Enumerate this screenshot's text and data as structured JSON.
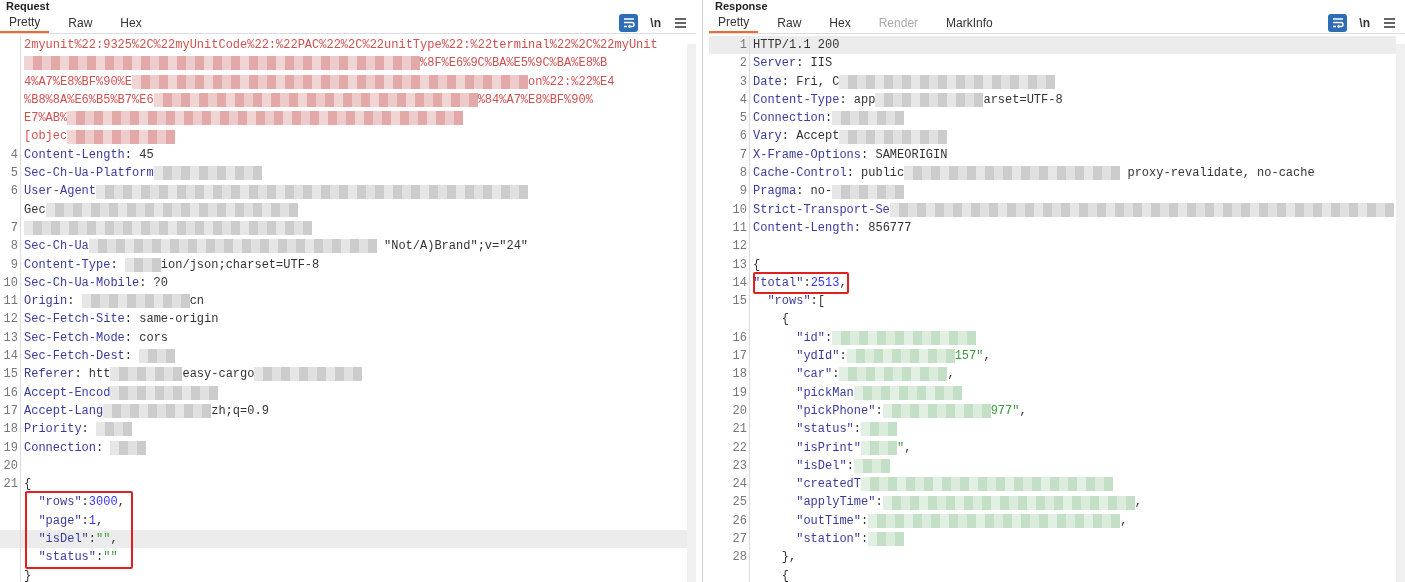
{
  "panels": [
    {
      "title": "Request",
      "tabs": [
        {
          "label": "Pretty",
          "selected": true,
          "disabled": false
        },
        {
          "label": "Raw",
          "selected": false,
          "disabled": false
        },
        {
          "label": "Hex",
          "selected": false,
          "disabled": false
        }
      ],
      "wrap_on": true,
      "newline_label": "\\n",
      "rows": [
        {
          "parts": [
            {
              "kind": "error",
              "text": "2myunit%22:9325%2C%22myUnitCode%22:%22PAC%22%2C%22unitType%22:%22terminal%22%2C%22myUnit"
            }
          ]
        },
        {
          "parts": [
            {
              "kind": "redacted",
              "color": "#e3a9a9"
            },
            {
              "kind": "redacted",
              "color": "#e3a9a9"
            },
            {
              "kind": "redacted",
              "color": "#e3a9a9"
            },
            {
              "kind": "redacted",
              "color": "#e3a9a9"
            },
            {
              "kind": "redacted",
              "color": "#e3a9a9"
            },
            {
              "kind": "redacted",
              "color": "#e3a9a9"
            },
            {
              "kind": "redacted",
              "color": "#e3a9a9"
            },
            {
              "kind": "redacted",
              "color": "#e3a9a9"
            },
            {
              "kind": "redacted",
              "color": "#e3a9a9"
            },
            {
              "kind": "redacted",
              "color": "#e3a9a9"
            },
            {
              "kind": "redacted",
              "color": "#e3a9a9"
            },
            {
              "kind": "error",
              "text": "%8F%E6%9C%BA%E5%9C%BA%E8%B"
            }
          ]
        },
        {
          "parts": [
            {
              "kind": "error",
              "text": "4%A7%E8%BF%90%E"
            },
            {
              "kind": "redacted",
              "color": "#e3a9a9"
            },
            {
              "kind": "redacted",
              "color": "#e3a9a9"
            },
            {
              "kind": "redacted",
              "color": "#e3a9a9"
            },
            {
              "kind": "redacted",
              "color": "#e3a9a9"
            },
            {
              "kind": "redacted",
              "color": "#e3a9a9"
            },
            {
              "kind": "redacted",
              "color": "#e3a9a9"
            },
            {
              "kind": "redacted",
              "color": "#e3a9a9"
            },
            {
              "kind": "redacted",
              "color": "#e3a9a9"
            },
            {
              "kind": "redacted",
              "color": "#e3a9a9"
            },
            {
              "kind": "redacted",
              "color": "#e3a9a9"
            },
            {
              "kind": "redacted",
              "color": "#e3a9a9"
            },
            {
              "kind": "error",
              "text": "on%22:%22%E4"
            }
          ]
        },
        {
          "parts": [
            {
              "kind": "error",
              "text": "%B8%8A%E6%B5%B7%E6"
            },
            {
              "kind": "redacted",
              "color": "#e3a9a9"
            },
            {
              "kind": "redacted",
              "color": "#e3a9a9"
            },
            {
              "kind": "redacted",
              "color": "#e3a9a9"
            },
            {
              "kind": "redacted",
              "color": "#e3a9a9"
            },
            {
              "kind": "redacted",
              "color": "#e3a9a9"
            },
            {
              "kind": "redacted",
              "color": "#e3a9a9"
            },
            {
              "kind": "redacted",
              "color": "#e3a9a9"
            },
            {
              "kind": "redacted",
              "color": "#e3a9a9"
            },
            {
              "kind": "redacted",
              "color": "#e3a9a9"
            },
            {
              "kind": "error",
              "text": "%84%A7%E8%BF%90%"
            }
          ]
        },
        {
          "parts": [
            {
              "kind": "error",
              "text": "E7%AB%"
            },
            {
              "kind": "redacted",
              "color": "#e3a9a9"
            },
            {
              "kind": "redacted",
              "color": "#e3a9a9"
            },
            {
              "kind": "redacted",
              "color": "#e3a9a9"
            },
            {
              "kind": "redacted",
              "color": "#e3a9a9"
            },
            {
              "kind": "redacted",
              "color": "#e3a9a9"
            },
            {
              "kind": "redacted",
              "color": "#e3a9a9"
            },
            {
              "kind": "redacted",
              "color": "#e3a9a9"
            },
            {
              "kind": "redacted",
              "color": "#e3a9a9"
            },
            {
              "kind": "redacted",
              "color": "#e3a9a9"
            },
            {
              "kind": "redacted",
              "color": "#e3a9a9"
            },
            {
              "kind": "redacted",
              "color": "#e3a9a9"
            }
          ]
        },
        {
          "parts": [
            {
              "kind": "error",
              "text": "[objec"
            },
            {
              "kind": "redacted",
              "color": "#e3a9a9"
            },
            {
              "kind": "redacted",
              "color": "#e3a9a9"
            },
            {
              "kind": "redacted",
              "color": "#e3a9a9"
            }
          ]
        },
        {
          "number": "4",
          "parts": [
            {
              "kind": "key",
              "text": "Content-Length"
            },
            {
              "kind": "plain",
              "text": ": 45"
            }
          ]
        },
        {
          "number": "5",
          "parts": [
            {
              "kind": "key",
              "text": "Sec-Ch-Ua-Platform"
            },
            {
              "kind": "redacted",
              "color": "#cccccc"
            },
            {
              "kind": "redacted",
              "color": "#cccccc"
            },
            {
              "kind": "redacted",
              "color": "#cccccc"
            }
          ]
        },
        {
          "number": "6",
          "parts": [
            {
              "kind": "key",
              "text": "User-Agent"
            },
            {
              "kind": "redacted",
              "color": "#cccccc"
            },
            {
              "kind": "redacted",
              "color": "#cccccc"
            },
            {
              "kind": "redacted",
              "color": "#cccccc"
            },
            {
              "kind": "redacted",
              "color": "#cccccc"
            },
            {
              "kind": "redacted",
              "color": "#cccccc"
            },
            {
              "kind": "redacted",
              "color": "#cccccc"
            },
            {
              "kind": "redacted",
              "color": "#cccccc"
            },
            {
              "kind": "redacted",
              "color": "#cccccc"
            },
            {
              "kind": "redacted",
              "color": "#cccccc"
            },
            {
              "kind": "redacted",
              "color": "#cccccc"
            },
            {
              "kind": "redacted",
              "color": "#cccccc"
            },
            {
              "kind": "redacted",
              "color": "#cccccc"
            }
          ]
        },
        {
          "parts": [
            {
              "kind": "plain",
              "text": "Gec"
            },
            {
              "kind": "redacted",
              "color": "#cccccc"
            },
            {
              "kind": "redacted",
              "color": "#cccccc"
            },
            {
              "kind": "redacted",
              "color": "#cccccc"
            },
            {
              "kind": "redacted",
              "color": "#cccccc"
            },
            {
              "kind": "redacted",
              "color": "#cccccc"
            },
            {
              "kind": "redacted",
              "color": "#cccccc"
            },
            {
              "kind": "redacted",
              "color": "#cccccc"
            }
          ]
        },
        {
          "number": "7",
          "parts": [
            {
              "kind": "redacted",
              "color": "#cccccc"
            },
            {
              "kind": "redacted",
              "color": "#cccccc"
            },
            {
              "kind": "redacted",
              "color": "#cccccc"
            },
            {
              "kind": "redacted",
              "color": "#cccccc"
            },
            {
              "kind": "redacted",
              "color": "#cccccc"
            },
            {
              "kind": "redacted",
              "color": "#cccccc"
            },
            {
              "kind": "redacted",
              "color": "#cccccc"
            },
            {
              "kind": "redacted",
              "color": "#cccccc"
            }
          ]
        },
        {
          "number": "8",
          "parts": [
            {
              "kind": "key",
              "text": "Sec-Ch-Ua"
            },
            {
              "kind": "redacted",
              "color": "#cccccc"
            },
            {
              "kind": "redacted",
              "color": "#cccccc"
            },
            {
              "kind": "redacted",
              "color": "#cccccc"
            },
            {
              "kind": "redacted",
              "color": "#cccccc"
            },
            {
              "kind": "redacted",
              "color": "#cccccc"
            },
            {
              "kind": "redacted",
              "color": "#cccccc"
            },
            {
              "kind": "redacted",
              "color": "#cccccc"
            },
            {
              "kind": "redacted",
              "color": "#cccccc"
            },
            {
              "kind": "plain",
              "text": " \"Not/A)Brand\";v=\"24\""
            }
          ]
        },
        {
          "number": "9",
          "parts": [
            {
              "kind": "key",
              "text": "Content-Type"
            },
            {
              "kind": "plain",
              "text": ": "
            },
            {
              "kind": "redacted",
              "color": "#cccccc"
            },
            {
              "kind": "plain",
              "text": "ion/json;charset=UTF-8"
            }
          ]
        },
        {
          "number": "10",
          "parts": [
            {
              "kind": "key",
              "text": "Sec-Ch-Ua-Mobile"
            },
            {
              "kind": "plain",
              "text": ": ?0"
            }
          ]
        },
        {
          "number": "11",
          "parts": [
            {
              "kind": "key",
              "text": "Origin"
            },
            {
              "kind": "plain",
              "text": ": "
            },
            {
              "kind": "redacted",
              "color": "#cccccc"
            },
            {
              "kind": "redacted",
              "color": "#cccccc"
            },
            {
              "kind": "redacted",
              "color": "#cccccc"
            },
            {
              "kind": "plain",
              "text": "cn"
            }
          ]
        },
        {
          "number": "12",
          "parts": [
            {
              "kind": "key",
              "text": "Sec-Fetch-Site"
            },
            {
              "kind": "plain",
              "text": ": same-origin"
            }
          ]
        },
        {
          "number": "13",
          "parts": [
            {
              "kind": "key",
              "text": "Sec-Fetch-Mode"
            },
            {
              "kind": "plain",
              "text": ": cors"
            }
          ]
        },
        {
          "number": "14",
          "parts": [
            {
              "kind": "key",
              "text": "Sec-Fetch-Dest"
            },
            {
              "kind": "plain",
              "text": ": "
            },
            {
              "kind": "redacted",
              "color": "#cccccc"
            }
          ]
        },
        {
          "number": "15",
          "parts": [
            {
              "kind": "key",
              "text": "Referer"
            },
            {
              "kind": "plain",
              "text": ": htt"
            },
            {
              "kind": "redacted",
              "color": "#cccccc"
            },
            {
              "kind": "redacted",
              "color": "#cccccc"
            },
            {
              "kind": "plain",
              "text": "easy-cargo"
            },
            {
              "kind": "redacted",
              "color": "#cccccc"
            },
            {
              "kind": "redacted",
              "color": "#cccccc"
            },
            {
              "kind": "redacted",
              "color": "#cccccc"
            }
          ]
        },
        {
          "number": "16",
          "parts": [
            {
              "kind": "key",
              "text": "Accept-Encod"
            },
            {
              "kind": "redacted",
              "color": "#cccccc"
            },
            {
              "kind": "redacted",
              "color": "#cccccc"
            },
            {
              "kind": "redacted",
              "color": "#cccccc"
            }
          ]
        },
        {
          "number": "17",
          "parts": [
            {
              "kind": "key",
              "text": "Accept-Lang"
            },
            {
              "kind": "redacted",
              "color": "#cccccc"
            },
            {
              "kind": "redacted",
              "color": "#cccccc"
            },
            {
              "kind": "redacted",
              "color": "#cccccc"
            },
            {
              "kind": "plain",
              "text": "zh;q=0.9"
            }
          ]
        },
        {
          "number": "18",
          "parts": [
            {
              "kind": "key",
              "text": "Priority"
            },
            {
              "kind": "plain",
              "text": ": "
            },
            {
              "kind": "redacted",
              "color": "#cccccc"
            }
          ]
        },
        {
          "number": "19",
          "parts": [
            {
              "kind": "key",
              "text": "Connection"
            },
            {
              "kind": "plain",
              "text": ": "
            },
            {
              "kind": "redacted",
              "color": "#cccccc"
            }
          ]
        },
        {
          "number": "20",
          "parts": []
        },
        {
          "number": "21",
          "parts": [
            {
              "kind": "punct",
              "text": "{"
            }
          ]
        },
        {
          "boxed": true,
          "parts": [
            {
              "kind": "key",
              "text": "  \"rows\""
            },
            {
              "kind": "punct",
              "text": ":"
            },
            {
              "kind": "number",
              "text": "3000"
            },
            {
              "kind": "punct",
              "text": ","
            }
          ]
        },
        {
          "boxed": true,
          "parts": [
            {
              "kind": "key",
              "text": "  \"page\""
            },
            {
              "kind": "punct",
              "text": ":"
            },
            {
              "kind": "number",
              "text": "1"
            },
            {
              "kind": "punct",
              "text": ","
            }
          ]
        },
        {
          "boxed": true,
          "highlighted": true,
          "parts": [
            {
              "kind": "key",
              "text": "  \"isDel\""
            },
            {
              "kind": "punct",
              "text": ":"
            },
            {
              "kind": "string",
              "text": "\"\""
            },
            {
              "kind": "punct",
              "text": ","
            }
          ]
        },
        {
          "boxed": true,
          "parts": [
            {
              "kind": "key",
              "text": "  \"status\""
            },
            {
              "kind": "punct",
              "text": ":"
            },
            {
              "kind": "string",
              "text": "\"\""
            }
          ]
        },
        {
          "parts": [
            {
              "kind": "punct",
              "text": "}"
            }
          ]
        }
      ]
    },
    {
      "title": "Response",
      "tabs": [
        {
          "label": "Pretty",
          "selected": true,
          "disabled": false
        },
        {
          "label": "Raw",
          "selected": false,
          "disabled": false
        },
        {
          "label": "Hex",
          "selected": false,
          "disabled": false
        },
        {
          "label": "Render",
          "selected": false,
          "disabled": true
        },
        {
          "label": "MarkInfo",
          "selected": false,
          "disabled": false
        }
      ],
      "wrap_on": true,
      "newline_label": "\\n",
      "rows": [
        {
          "number": "1",
          "highlighted": true,
          "parts": [
            {
              "kind": "plain",
              "text": "HTTP/1.1 200"
            }
          ]
        },
        {
          "number": "2",
          "parts": [
            {
              "kind": "key",
              "text": "Server"
            },
            {
              "kind": "plain",
              "text": ": IIS"
            }
          ]
        },
        {
          "number": "3",
          "parts": [
            {
              "kind": "key",
              "text": "Date"
            },
            {
              "kind": "plain",
              "text": ": Fri, C"
            },
            {
              "kind": "redacted",
              "color": "#cccccc"
            },
            {
              "kind": "redacted",
              "color": "#cccccc"
            },
            {
              "kind": "redacted",
              "color": "#cccccc"
            },
            {
              "kind": "redacted",
              "color": "#cccccc"
            },
            {
              "kind": "redacted",
              "color": "#cccccc"
            },
            {
              "kind": "redacted",
              "color": "#cccccc"
            }
          ]
        },
        {
          "number": "4",
          "parts": [
            {
              "kind": "key",
              "text": "Content-Type"
            },
            {
              "kind": "plain",
              "text": ": app"
            },
            {
              "kind": "redacted",
              "color": "#cccccc"
            },
            {
              "kind": "redacted",
              "color": "#cccccc"
            },
            {
              "kind": "redacted",
              "color": "#cccccc"
            },
            {
              "kind": "plain",
              "text": "arset=UTF-8"
            }
          ]
        },
        {
          "number": "5",
          "parts": [
            {
              "kind": "key",
              "text": "Connection"
            },
            {
              "kind": "plain",
              "text": ":"
            },
            {
              "kind": "redacted",
              "color": "#cccccc"
            },
            {
              "kind": "redacted",
              "color": "#cccccc"
            }
          ]
        },
        {
          "number": "6",
          "parts": [
            {
              "kind": "key",
              "text": "Vary"
            },
            {
              "kind": "plain",
              "text": ": Accept"
            },
            {
              "kind": "redacted",
              "color": "#cccccc"
            },
            {
              "kind": "redacted",
              "color": "#cccccc"
            },
            {
              "kind": "redacted",
              "color": "#cccccc"
            }
          ]
        },
        {
          "number": "7",
          "parts": [
            {
              "kind": "key",
              "text": "X-Frame-Options"
            },
            {
              "kind": "plain",
              "text": ": SAMEORIGIN"
            }
          ]
        },
        {
          "number": "8",
          "parts": [
            {
              "kind": "key",
              "text": "Cache-Control"
            },
            {
              "kind": "plain",
              "text": ": public"
            },
            {
              "kind": "redacted",
              "color": "#cccccc"
            },
            {
              "kind": "redacted",
              "color": "#cccccc"
            },
            {
              "kind": "redacted",
              "color": "#cccccc"
            },
            {
              "kind": "redacted",
              "color": "#cccccc"
            },
            {
              "kind": "redacted",
              "color": "#cccccc"
            },
            {
              "kind": "redacted",
              "color": "#cccccc"
            },
            {
              "kind": "plain",
              "text": " proxy-revalidate, no-cache"
            }
          ]
        },
        {
          "number": "9",
          "parts": [
            {
              "kind": "key",
              "text": "Pragma"
            },
            {
              "kind": "plain",
              "text": ": no-"
            },
            {
              "kind": "redacted",
              "color": "#cccccc"
            },
            {
              "kind": "redacted",
              "color": "#cccccc"
            }
          ]
        },
        {
          "number": "10",
          "parts": [
            {
              "kind": "key",
              "text": "Strict-Transport-Se"
            },
            {
              "kind": "redacted",
              "color": "#cccccc"
            },
            {
              "kind": "redacted",
              "color": "#cccccc"
            },
            {
              "kind": "redacted",
              "color": "#cccccc"
            },
            {
              "kind": "redacted",
              "color": "#cccccc"
            },
            {
              "kind": "redacted",
              "color": "#cccccc"
            },
            {
              "kind": "redacted",
              "color": "#cccccc"
            },
            {
              "kind": "redacted",
              "color": "#cccccc"
            },
            {
              "kind": "redacted",
              "color": "#cccccc"
            },
            {
              "kind": "redacted",
              "color": "#cccccc"
            },
            {
              "kind": "redacted",
              "color": "#cccccc"
            },
            {
              "kind": "redacted",
              "color": "#cccccc"
            },
            {
              "kind": "redacted",
              "color": "#cccccc"
            },
            {
              "kind": "redacted",
              "color": "#cccccc"
            },
            {
              "kind": "redacted",
              "color": "#cccccc"
            }
          ]
        },
        {
          "number": "11",
          "parts": [
            {
              "kind": "key",
              "text": "Content-Length"
            },
            {
              "kind": "plain",
              "text": ": 856777"
            }
          ]
        },
        {
          "number": "12",
          "parts": []
        },
        {
          "number": "13",
          "parts": [
            {
              "kind": "punct",
              "text": "{"
            }
          ]
        },
        {
          "number": "14",
          "boxed": true,
          "parts": [
            {
              "kind": "key",
              "text": "\"total\""
            },
            {
              "kind": "punct",
              "text": ":"
            },
            {
              "kind": "number",
              "text": "2513"
            },
            {
              "kind": "punct",
              "text": ","
            }
          ]
        },
        {
          "number": "15",
          "parts": [
            {
              "kind": "key",
              "text": "  \"rows\""
            },
            {
              "kind": "punct",
              "text": ":["
            }
          ]
        },
        {
          "parts": [
            {
              "kind": "punct",
              "text": "    {"
            }
          ]
        },
        {
          "number": "16",
          "parts": [
            {
              "kind": "key",
              "text": "      \"id\""
            },
            {
              "kind": "punct",
              "text": ":"
            },
            {
              "kind": "redacted",
              "color": "#c3e0c6"
            },
            {
              "kind": "redacted",
              "color": "#c3e0c6"
            },
            {
              "kind": "redacted",
              "color": "#c3e0c6"
            },
            {
              "kind": "redacted",
              "color": "#c3e0c6"
            }
          ]
        },
        {
          "number": "17",
          "parts": [
            {
              "kind": "key",
              "text": "      \"ydId\""
            },
            {
              "kind": "punct",
              "text": ":"
            },
            {
              "kind": "redacted",
              "color": "#c3e0c6"
            },
            {
              "kind": "redacted",
              "color": "#c3e0c6"
            },
            {
              "kind": "redacted",
              "color": "#c3e0c6"
            },
            {
              "kind": "string",
              "text": "157\""
            },
            {
              "kind": "punct",
              "text": ","
            }
          ]
        },
        {
          "number": "18",
          "parts": [
            {
              "kind": "key",
              "text": "      \"car\""
            },
            {
              "kind": "punct",
              "text": ":"
            },
            {
              "kind": "redacted",
              "color": "#c3e0c6"
            },
            {
              "kind": "redacted",
              "color": "#c3e0c6"
            },
            {
              "kind": "redacted",
              "color": "#c3e0c6"
            },
            {
              "kind": "punct",
              "text": ","
            }
          ]
        },
        {
          "number": "19",
          "parts": [
            {
              "kind": "key",
              "text": "      \"pickMan"
            },
            {
              "kind": "redacted",
              "color": "#c3e0c6"
            },
            {
              "kind": "redacted",
              "color": "#c3e0c6"
            },
            {
              "kind": "redacted",
              "color": "#c3e0c6"
            }
          ]
        },
        {
          "number": "20",
          "parts": [
            {
              "kind": "key",
              "text": "      \"pickPhone\""
            },
            {
              "kind": "punct",
              "text": ":"
            },
            {
              "kind": "redacted",
              "color": "#c3e0c6"
            },
            {
              "kind": "redacted",
              "color": "#c3e0c6"
            },
            {
              "kind": "redacted",
              "color": "#c3e0c6"
            },
            {
              "kind": "string",
              "text": "977\""
            },
            {
              "kind": "punct",
              "text": ","
            }
          ]
        },
        {
          "number": "21",
          "parts": [
            {
              "kind": "key",
              "text": "      \"status\""
            },
            {
              "kind": "punct",
              "text": ":"
            },
            {
              "kind": "redacted",
              "color": "#c3e0c6"
            }
          ]
        },
        {
          "number": "22",
          "parts": [
            {
              "kind": "key",
              "text": "      \"isPrint\""
            },
            {
              "kind": "redacted",
              "color": "#c3e0c6"
            },
            {
              "kind": "string",
              "text": "\""
            },
            {
              "kind": "punct",
              "text": ","
            }
          ]
        },
        {
          "number": "23",
          "parts": [
            {
              "kind": "key",
              "text": "      \"isDel\""
            },
            {
              "kind": "punct",
              "text": ":"
            },
            {
              "kind": "redacted",
              "color": "#c3e0c6"
            }
          ]
        },
        {
          "number": "24",
          "parts": [
            {
              "kind": "key",
              "text": "      \"createdT"
            },
            {
              "kind": "redacted",
              "color": "#c3e0c6"
            },
            {
              "kind": "redacted",
              "color": "#c3e0c6"
            },
            {
              "kind": "redacted",
              "color": "#c3e0c6"
            },
            {
              "kind": "redacted",
              "color": "#c3e0c6"
            },
            {
              "kind": "redacted",
              "color": "#c3e0c6"
            },
            {
              "kind": "redacted",
              "color": "#c3e0c6"
            },
            {
              "kind": "redacted",
              "color": "#c3e0c6"
            }
          ]
        },
        {
          "number": "25",
          "parts": [
            {
              "kind": "key",
              "text": "      \"applyTime\""
            },
            {
              "kind": "punct",
              "text": ":"
            },
            {
              "kind": "redacted",
              "color": "#c3e0c6"
            },
            {
              "kind": "redacted",
              "color": "#c3e0c6"
            },
            {
              "kind": "redacted",
              "color": "#c3e0c6"
            },
            {
              "kind": "redacted",
              "color": "#c3e0c6"
            },
            {
              "kind": "redacted",
              "color": "#c3e0c6"
            },
            {
              "kind": "redacted",
              "color": "#c3e0c6"
            },
            {
              "kind": "redacted",
              "color": "#c3e0c6"
            },
            {
              "kind": "punct",
              "text": ","
            }
          ]
        },
        {
          "number": "26",
          "parts": [
            {
              "kind": "key",
              "text": "      \"outTime\""
            },
            {
              "kind": "punct",
              "text": ":"
            },
            {
              "kind": "redacted",
              "color": "#c3e0c6"
            },
            {
              "kind": "redacted",
              "color": "#c3e0c6"
            },
            {
              "kind": "redacted",
              "color": "#c3e0c6"
            },
            {
              "kind": "redacted",
              "color": "#c3e0c6"
            },
            {
              "kind": "redacted",
              "color": "#c3e0c6"
            },
            {
              "kind": "redacted",
              "color": "#c3e0c6"
            },
            {
              "kind": "redacted",
              "color": "#c3e0c6"
            },
            {
              "kind": "punct",
              "text": ","
            }
          ]
        },
        {
          "number": "27",
          "parts": [
            {
              "kind": "key",
              "text": "      \"station\""
            },
            {
              "kind": "punct",
              "text": ":"
            },
            {
              "kind": "redacted",
              "color": "#c3e0c6"
            }
          ]
        },
        {
          "number": "28",
          "parts": [
            {
              "kind": "punct",
              "text": "    },"
            }
          ]
        },
        {
          "parts": [
            {
              "kind": "punct",
              "text": "    {"
            }
          ]
        }
      ]
    }
  ]
}
